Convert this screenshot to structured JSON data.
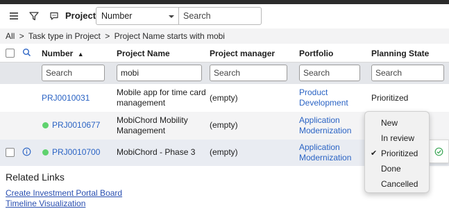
{
  "toolbar": {
    "menu_icon": "hamburger-icon",
    "filter_icon": "funnel-icon",
    "chat_icon": "chat-bubble-icon",
    "title": "Projects",
    "search_field_select": "Number",
    "search_placeholder": "Search"
  },
  "breadcrumb": {
    "items": [
      "All",
      ">",
      "Task type in Project",
      ">",
      "Project Name starts with mobi"
    ]
  },
  "table": {
    "search_icon": "search-icon",
    "columns": [
      "Number",
      "Project Name",
      "Project manager",
      "Portfolio",
      "Planning State"
    ],
    "sort_indicator": "▲",
    "filters": {
      "number": "",
      "project_name": "mobi",
      "project_manager": "",
      "portfolio": "",
      "planning_state": ""
    },
    "filter_placeholder": "Search",
    "rows": [
      {
        "number": "PRJ0010031",
        "name_line1": "Mobile app for time card",
        "name_line2": "management",
        "manager": "(empty)",
        "portfolio_line1": "Product",
        "portfolio_line2": "Development",
        "state": "Prioritized",
        "status_dot": false
      },
      {
        "number": "PRJ0010677",
        "name_line1": "MobiChord Mobility",
        "name_line2": "Management",
        "manager": "(empty)",
        "portfolio_line1": "Application",
        "portfolio_line2": "Modernization",
        "state": "",
        "status_dot": true
      },
      {
        "number": "PRJ0010700",
        "name_line1": "MobiChord - Phase 3",
        "name_line2": "",
        "manager": "(empty)",
        "portfolio_line1": "Application",
        "portfolio_line2": "Modernization",
        "state": "",
        "status_dot": true
      }
    ]
  },
  "state_dropdown": {
    "options": [
      "New",
      "In review",
      "Prioritized",
      "Done",
      "Cancelled"
    ],
    "selected": "Prioritized",
    "check_glyph": "✔"
  },
  "related": {
    "title": "Related Links",
    "links": [
      "Create Investment Portal Board",
      "Timeline Visualization"
    ]
  },
  "colors": {
    "link": "#2a63c4",
    "status_dot": "#5fd26e",
    "filter_row_bg": "#e4e6ea",
    "breadcrumb_bg": "#f3f3f4"
  }
}
